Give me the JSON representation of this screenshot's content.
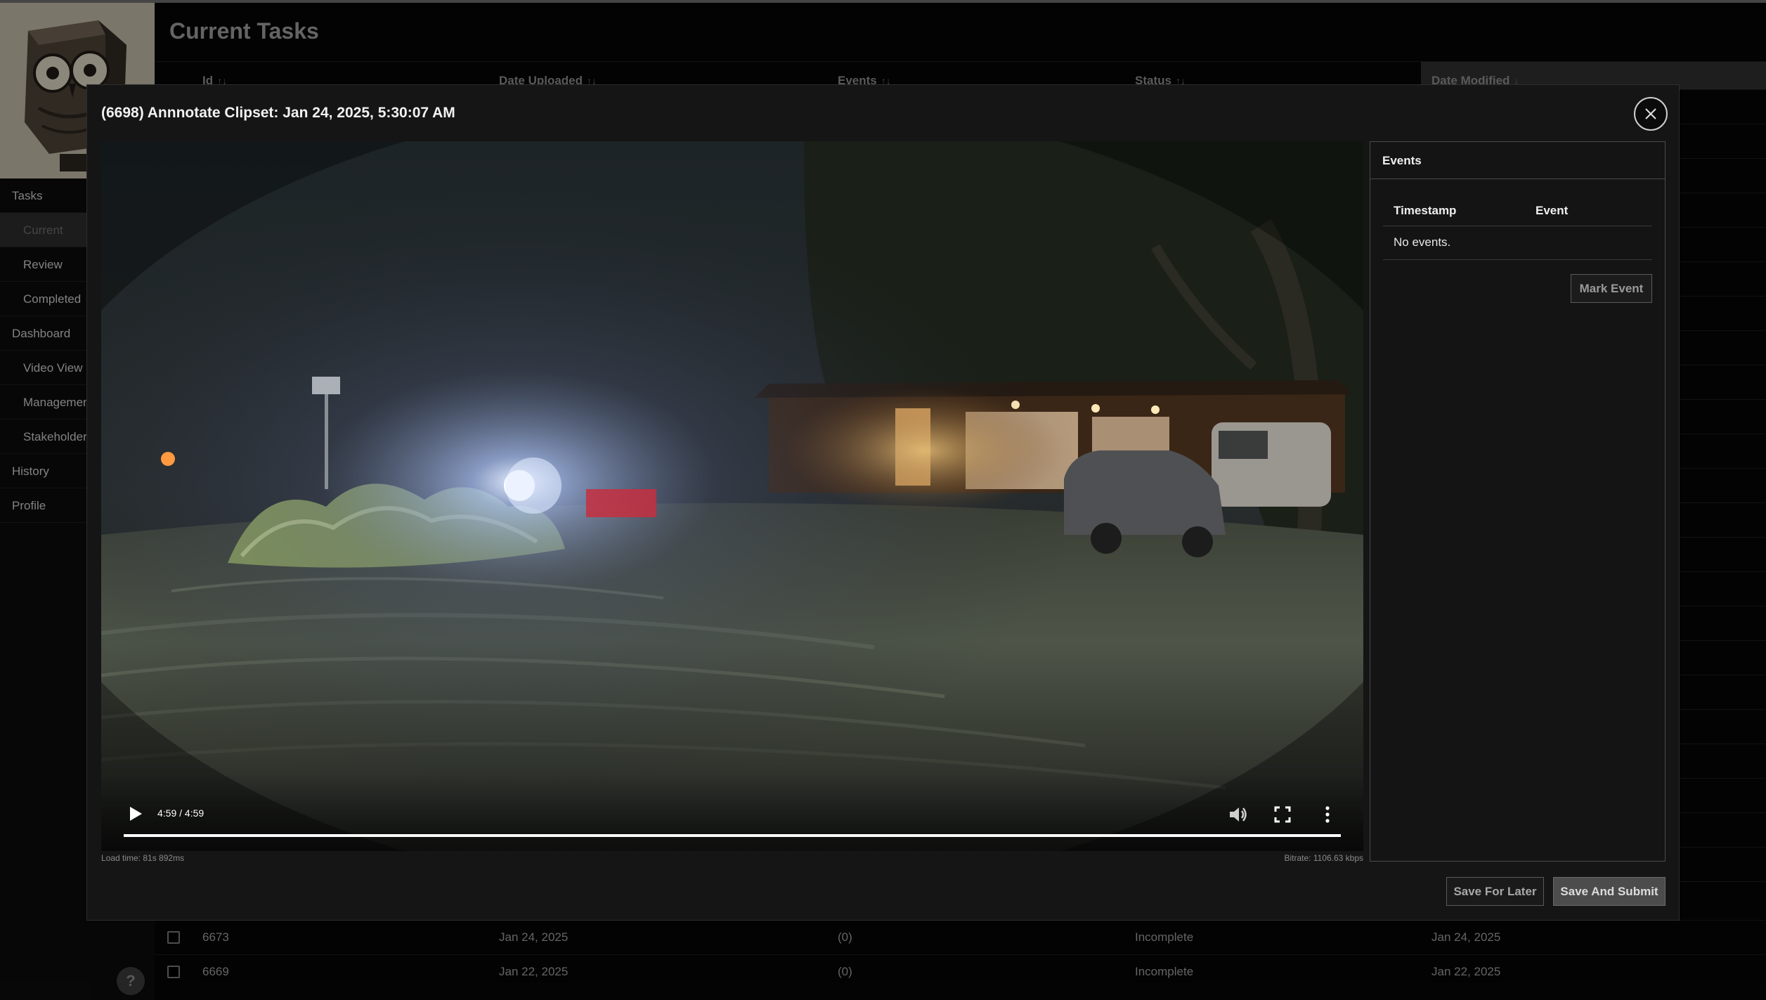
{
  "sidebar": {
    "items": [
      {
        "label": "Tasks",
        "level": "top",
        "active": false
      },
      {
        "label": "Current",
        "level": "sub",
        "active": true
      },
      {
        "label": "Review",
        "level": "sub",
        "active": false
      },
      {
        "label": "Completed",
        "level": "sub",
        "active": false
      },
      {
        "label": "Dashboard",
        "level": "top",
        "active": false
      },
      {
        "label": "Video View",
        "level": "sub",
        "active": false
      },
      {
        "label": "Management",
        "level": "sub",
        "active": false
      },
      {
        "label": "Stakeholders",
        "level": "sub",
        "active": false
      },
      {
        "label": "History",
        "level": "top",
        "active": false
      },
      {
        "label": "Profile",
        "level": "top",
        "active": false
      }
    ],
    "help_label": "?"
  },
  "main": {
    "title": "Current Tasks",
    "columns": [
      {
        "label": "Id",
        "sort_icon": "sort-icon"
      },
      {
        "label": "Date Uploaded",
        "sort_icon": "sort-icon"
      },
      {
        "label": "Events",
        "sort_icon": "sort-icon"
      },
      {
        "label": "Status",
        "sort_icon": "sort-icon"
      },
      {
        "label": "Date Modified",
        "sort_icon": "sort-desc-icon"
      }
    ],
    "rows": [
      {
        "id": "6673",
        "date_uploaded": "Jan 24, 2025",
        "events": "(0)",
        "status": "Incomplete",
        "date_modified": "Jan 24, 2025"
      },
      {
        "id": "6669",
        "date_uploaded": "Jan 22, 2025",
        "events": "(0)",
        "status": "Incomplete",
        "date_modified": "Jan 22, 2025"
      }
    ]
  },
  "modal": {
    "title": "(6698) Annnotate Clipset: Jan 24, 2025, 5:30:07 AM",
    "close_icon": "close-icon",
    "video": {
      "time_display": "4:59 / 4:59",
      "progress_fraction": 1.0,
      "load_time": "Load time: 81s 892ms",
      "bitrate": "Bitrate: 1106.63 kbps"
    },
    "events_panel": {
      "title": "Events",
      "col_timestamp": "Timestamp",
      "col_event": "Event",
      "empty_text": "No events.",
      "mark_button": "Mark Event"
    },
    "save_later_button": "Save For Later",
    "save_submit_button": "Save And Submit"
  }
}
